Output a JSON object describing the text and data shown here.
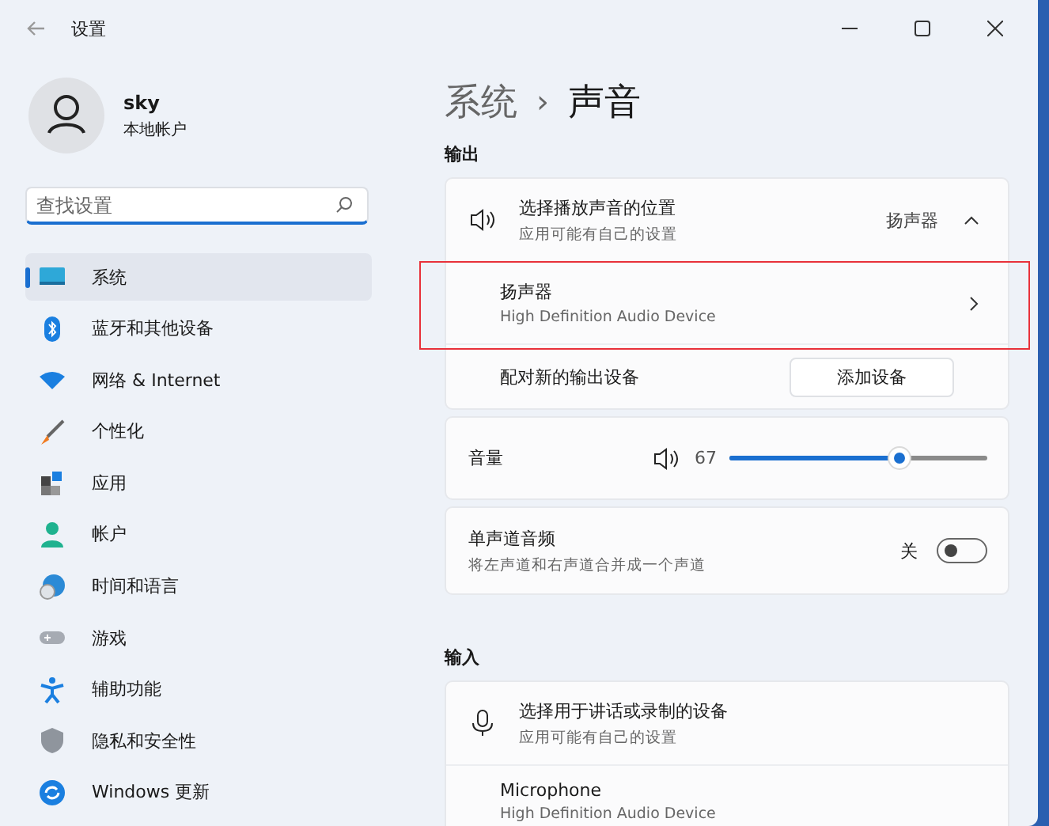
{
  "window": {
    "title": "设置"
  },
  "profile": {
    "name": "sky",
    "account_type": "本地帐户"
  },
  "search": {
    "placeholder": "查找设置"
  },
  "sidebar": {
    "items": [
      {
        "label": "系统",
        "selected": true
      },
      {
        "label": "蓝牙和其他设备",
        "selected": false
      },
      {
        "label": "网络 & Internet",
        "selected": false
      },
      {
        "label": "个性化",
        "selected": false
      },
      {
        "label": "应用",
        "selected": false
      },
      {
        "label": "帐户",
        "selected": false
      },
      {
        "label": "时间和语言",
        "selected": false
      },
      {
        "label": "游戏",
        "selected": false
      },
      {
        "label": "辅助功能",
        "selected": false
      },
      {
        "label": "隐私和安全性",
        "selected": false
      },
      {
        "label": "Windows 更新",
        "selected": false
      }
    ]
  },
  "breadcrumb": {
    "parent": "系统",
    "separator": "›",
    "current": "声音"
  },
  "output": {
    "heading": "输出",
    "location": {
      "title": "选择播放声音的位置",
      "subtitle": "应用可能有自己的设置",
      "value": "扬声器",
      "expanded": true
    },
    "devices": [
      {
        "name": "扬声器",
        "description": "High Definition Audio Device",
        "highlighted": true
      }
    ],
    "pair": {
      "label": "配对新的输出设备",
      "button": "添加设备"
    }
  },
  "volume": {
    "label": "音量",
    "reading": "67",
    "level": 0.67
  },
  "mono": {
    "title": "单声道音频",
    "subtitle": "将左声道和右声道合并成一个声道",
    "state_label": "关",
    "on": false
  },
  "input": {
    "heading": "输入",
    "location": {
      "title": "选择用于讲话或录制的设备",
      "subtitle": "应用可能有自己的设置"
    },
    "devices": [
      {
        "name": "Microphone",
        "description": "High Definition Audio Device"
      }
    ]
  }
}
